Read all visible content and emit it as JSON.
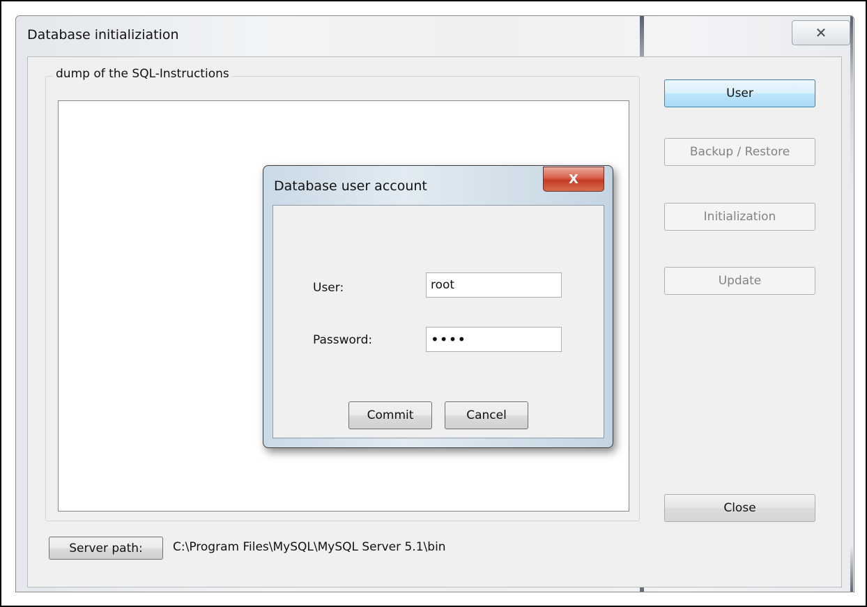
{
  "main_window": {
    "title": "Database initializiation",
    "close_glyph": "✕"
  },
  "sql_group": {
    "legend": "dump of the SQL-Instructions"
  },
  "side_buttons": {
    "user": "User",
    "backup_restore": "Backup / Restore",
    "initialization": "Initialization",
    "update": "Update",
    "close": "Close"
  },
  "server": {
    "button_label": "Server path:",
    "path": "C:\\Program Files\\MySQL\\MySQL Server 5.1\\bin"
  },
  "dialog": {
    "title": "Database user account",
    "close_glyph": "X",
    "user_label": "User:",
    "user_value": "root",
    "password_label": "Password:",
    "password_value": "••••",
    "commit": "Commit",
    "cancel": "Cancel"
  }
}
